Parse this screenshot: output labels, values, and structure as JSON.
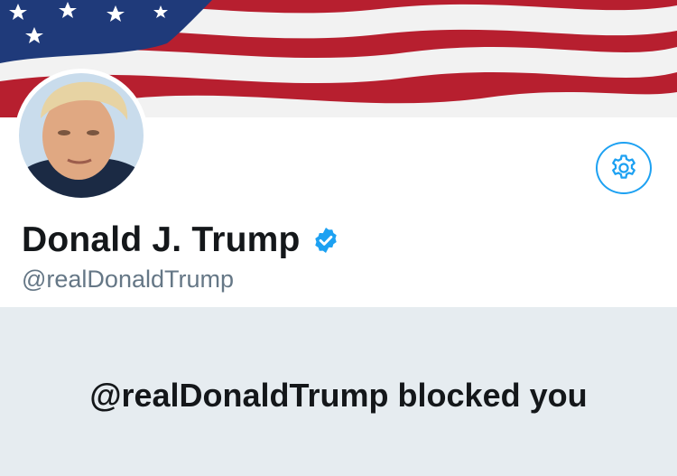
{
  "profile": {
    "display_name": "Donald J. Trump",
    "handle": "@realDonaldTrump",
    "verified": true,
    "blocked_message": "@realDonaldTrump blocked you"
  },
  "icons": {
    "settings": "gear-icon",
    "verified": "verified-badge-icon",
    "avatar": "profile-photo"
  },
  "colors": {
    "accent": "#1da1f2",
    "name_text": "#14171a",
    "handle_text": "#657786",
    "blocked_panel_bg": "#e6ecf0",
    "banner_red": "#b71f2f",
    "banner_blue": "#1f3a7a"
  }
}
